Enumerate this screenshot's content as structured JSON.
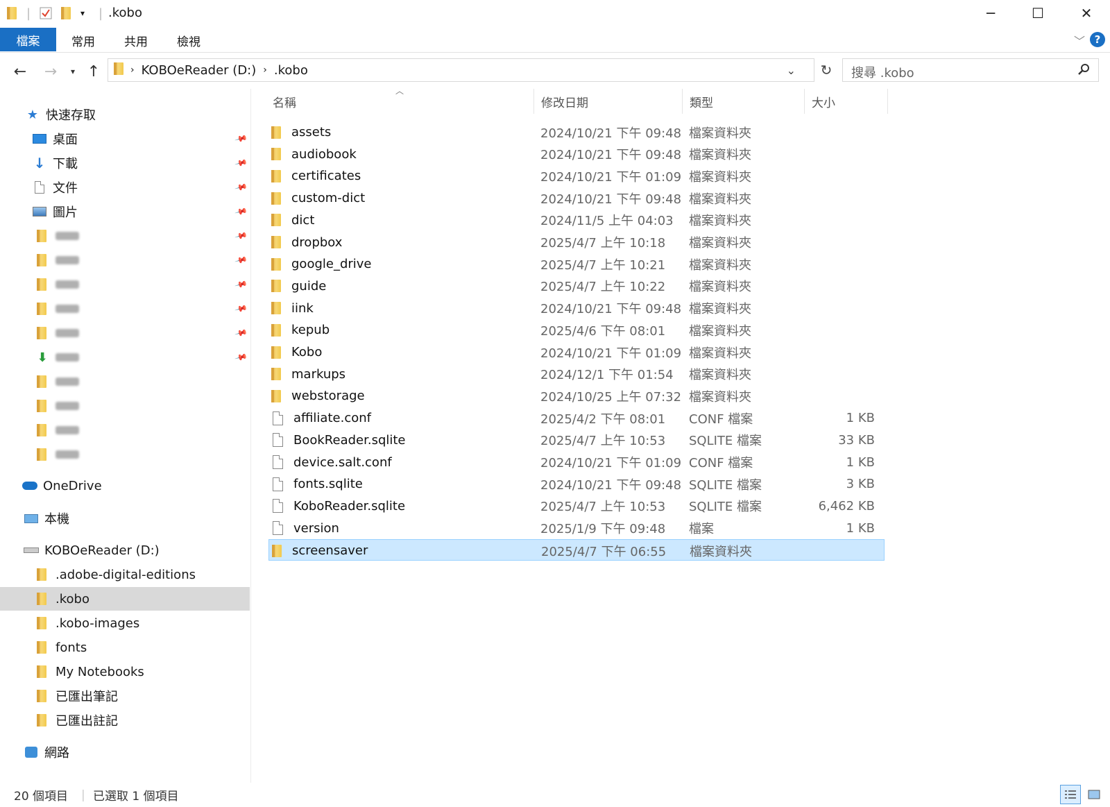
{
  "window": {
    "title": ".kobo",
    "minimize": "─",
    "maximize": "☐",
    "close": "✕"
  },
  "ribbon": {
    "tabs": [
      "檔案",
      "常用",
      "共用",
      "檢視"
    ],
    "help": "?"
  },
  "address": {
    "segments": [
      "KOBOeReader (D:)",
      ".kobo"
    ],
    "search_placeholder": "搜尋 .kobo"
  },
  "nav": {
    "quick_access": "快速存取",
    "pinned": [
      {
        "label": "桌面",
        "icon": "desktop-icon"
      },
      {
        "label": "下載",
        "icon": "download-icon"
      },
      {
        "label": "文件",
        "icon": "document-icon"
      },
      {
        "label": "圖片",
        "icon": "pictures-icon"
      }
    ],
    "onedrive": "OneDrive",
    "this_pc": "本機",
    "drive": "KOBOeReader (D:)",
    "drive_folders": [
      ".adobe-digital-editions",
      ".kobo",
      ".kobo-images",
      "fonts",
      "My Notebooks",
      "已匯出筆記",
      "已匯出註記"
    ],
    "network": "網路"
  },
  "columns": {
    "name": "名稱",
    "date": "修改日期",
    "type": "類型",
    "size": "大小"
  },
  "files": [
    {
      "name": "assets",
      "date": "2024/10/21 下午 09:48",
      "type": "檔案資料夾",
      "size": "",
      "kind": "folder"
    },
    {
      "name": "audiobook",
      "date": "2024/10/21 下午 09:48",
      "type": "檔案資料夾",
      "size": "",
      "kind": "folder"
    },
    {
      "name": "certificates",
      "date": "2024/10/21 下午 01:09",
      "type": "檔案資料夾",
      "size": "",
      "kind": "folder"
    },
    {
      "name": "custom-dict",
      "date": "2024/10/21 下午 09:48",
      "type": "檔案資料夾",
      "size": "",
      "kind": "folder"
    },
    {
      "name": "dict",
      "date": "2024/11/5 上午 04:03",
      "type": "檔案資料夾",
      "size": "",
      "kind": "folder"
    },
    {
      "name": "dropbox",
      "date": "2025/4/7 上午 10:18",
      "type": "檔案資料夾",
      "size": "",
      "kind": "folder"
    },
    {
      "name": "google_drive",
      "date": "2025/4/7 上午 10:21",
      "type": "檔案資料夾",
      "size": "",
      "kind": "folder"
    },
    {
      "name": "guide",
      "date": "2025/4/7 上午 10:22",
      "type": "檔案資料夾",
      "size": "",
      "kind": "folder"
    },
    {
      "name": "iink",
      "date": "2024/10/21 下午 09:48",
      "type": "檔案資料夾",
      "size": "",
      "kind": "folder"
    },
    {
      "name": "kepub",
      "date": "2025/4/6 下午 08:01",
      "type": "檔案資料夾",
      "size": "",
      "kind": "folder"
    },
    {
      "name": "Kobo",
      "date": "2024/10/21 下午 01:09",
      "type": "檔案資料夾",
      "size": "",
      "kind": "folder"
    },
    {
      "name": "markups",
      "date": "2024/12/1 下午 01:54",
      "type": "檔案資料夾",
      "size": "",
      "kind": "folder"
    },
    {
      "name": "webstorage",
      "date": "2024/10/25 上午 07:32",
      "type": "檔案資料夾",
      "size": "",
      "kind": "folder"
    },
    {
      "name": "affiliate.conf",
      "date": "2025/4/2 下午 08:01",
      "type": "CONF 檔案",
      "size": "1 KB",
      "kind": "file"
    },
    {
      "name": "BookReader.sqlite",
      "date": "2025/4/7 上午 10:53",
      "type": "SQLITE 檔案",
      "size": "33 KB",
      "kind": "file"
    },
    {
      "name": "device.salt.conf",
      "date": "2024/10/21 下午 01:09",
      "type": "CONF 檔案",
      "size": "1 KB",
      "kind": "file"
    },
    {
      "name": "fonts.sqlite",
      "date": "2024/10/21 下午 09:48",
      "type": "SQLITE 檔案",
      "size": "3 KB",
      "kind": "file"
    },
    {
      "name": "KoboReader.sqlite",
      "date": "2025/4/7 上午 10:53",
      "type": "SQLITE 檔案",
      "size": "6,462 KB",
      "kind": "file"
    },
    {
      "name": "version",
      "date": "2025/1/9 下午 09:48",
      "type": "檔案",
      "size": "1 KB",
      "kind": "file"
    },
    {
      "name": "screensaver",
      "date": "2025/4/7 下午 06:55",
      "type": "檔案資料夾",
      "size": "",
      "kind": "folder",
      "selected": true
    }
  ],
  "status": {
    "count": "20 個項目",
    "selected": "已選取 1 個項目"
  }
}
